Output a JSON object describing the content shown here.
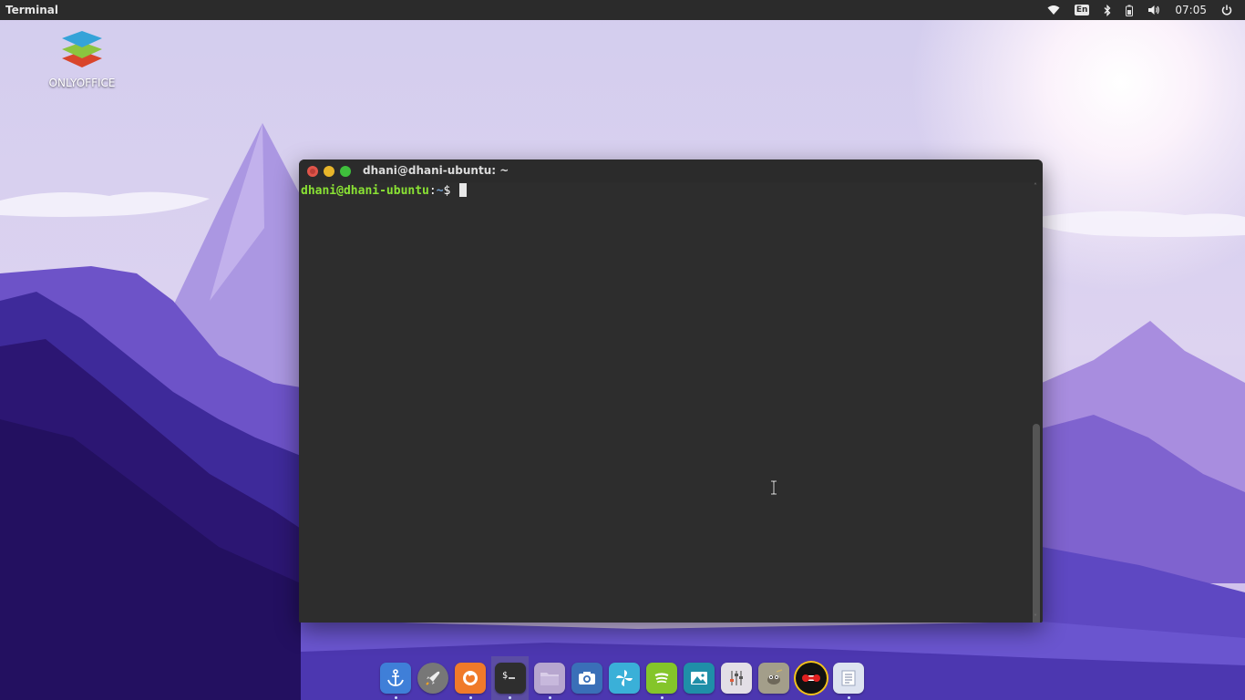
{
  "top_panel": {
    "app_title": "Terminal",
    "keyboard_layout": "En",
    "clock": "07:05",
    "icons": [
      "wifi-icon",
      "keyboard-layout-icon",
      "bluetooth-icon",
      "battery-icon",
      "volume-icon",
      "power-icon"
    ]
  },
  "desktop": {
    "icons": [
      {
        "label": "ONLYOFFICE",
        "icon": "onlyoffice-icon"
      }
    ]
  },
  "terminal": {
    "title": "dhani@dhani-ubuntu: ~",
    "prompt_user": "dhani@dhani-ubuntu",
    "prompt_sep": ":",
    "prompt_path": "~",
    "prompt_symbol": "$"
  },
  "dock": {
    "items": [
      {
        "icon": "anchor-icon",
        "running": true,
        "active": false
      },
      {
        "icon": "rocket-launcher-icon",
        "running": false,
        "active": false
      },
      {
        "icon": "firefox-icon",
        "running": true,
        "active": false
      },
      {
        "icon": "terminal-icon",
        "running": true,
        "active": true
      },
      {
        "icon": "files-icon",
        "running": true,
        "active": false
      },
      {
        "icon": "screenshot-camera-icon",
        "running": false,
        "active": false
      },
      {
        "icon": "blue-swirl-icon",
        "running": false,
        "active": false
      },
      {
        "icon": "spotify-icon",
        "running": true,
        "active": false
      },
      {
        "icon": "image-viewer-icon",
        "running": false,
        "active": false
      },
      {
        "icon": "settings-sliders-icon",
        "running": false,
        "active": false
      },
      {
        "icon": "gimp-icon",
        "running": false,
        "active": false
      },
      {
        "icon": "red-robot-icon",
        "running": false,
        "active": false
      },
      {
        "icon": "text-editor-icon",
        "running": true,
        "active": false
      }
    ]
  },
  "colors": {
    "panel_bg": "#2b2b2b",
    "terminal_bg": "#2d2d2d",
    "prompt_user": "#8ae234",
    "prompt_path": "#729fcf",
    "close_button": "#e0554a",
    "minimize_button": "#e8b52a",
    "maximize_button": "#3fbf3c"
  }
}
